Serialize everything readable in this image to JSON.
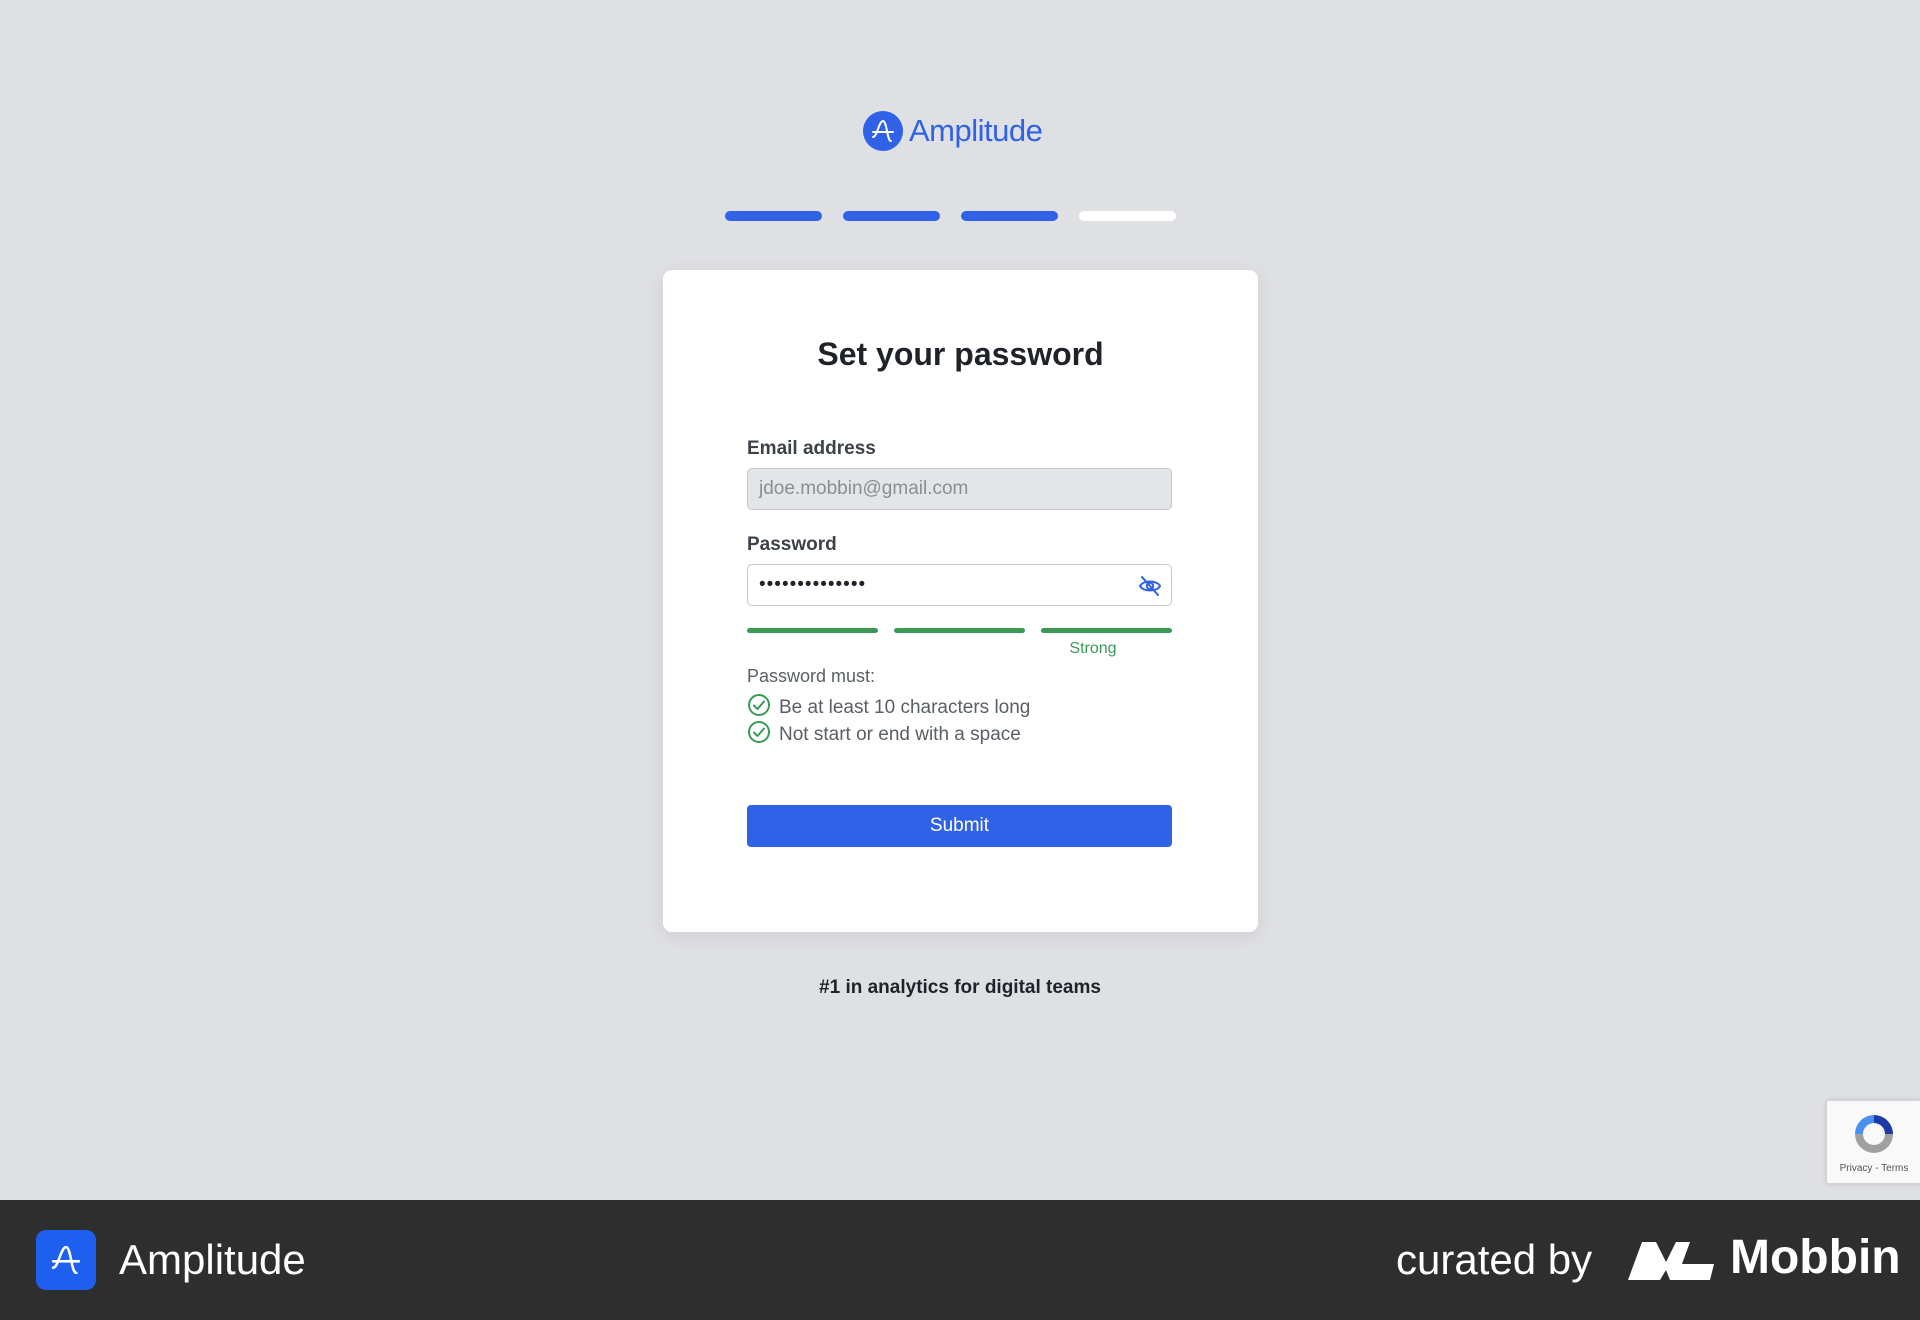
{
  "brand": {
    "name": "Amplitude",
    "color": "#2f62e6"
  },
  "progress": {
    "total_steps": 4,
    "completed_steps": 3,
    "active_color": "#2f62e6",
    "inactive_color": "#ffffff"
  },
  "card": {
    "title": "Set your password",
    "email": {
      "label": "Email address",
      "value": "jdoe.mobbin@gmail.com"
    },
    "password": {
      "label": "Password",
      "masked_value": "••••••••••••••",
      "toggle_icon": "eye-slash-icon"
    },
    "strength": {
      "level": 3,
      "max": 3,
      "label": "Strong",
      "color": "#3a9a55"
    },
    "rules": {
      "title": "Password must:",
      "items": [
        {
          "text": "Be at least 10 characters long",
          "met": true
        },
        {
          "text": "Not start or end with a space",
          "met": true
        }
      ]
    },
    "submit_label": "Submit"
  },
  "tagline": "#1 in analytics for digital teams",
  "recaptcha": {
    "links": "Privacy - Terms"
  },
  "footer": {
    "app_name": "Amplitude",
    "curated_by": "curated by",
    "curator": "Mobbin"
  }
}
